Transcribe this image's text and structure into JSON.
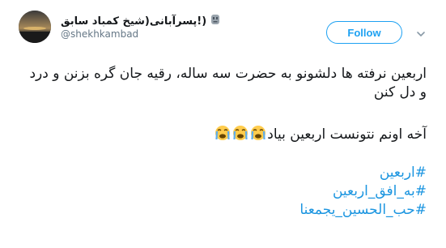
{
  "user": {
    "display_name": "(!پسرآبانی(شیخ کمباد سابق",
    "handle": "@shekhkambad",
    "badge_icon": "moai-icon"
  },
  "follow_label": "Follow",
  "tweet": {
    "line1": "اربعین نرفته ها دلشونو به حضرت سه ساله، رقیه جان گره بزنن و درد و دل کنن",
    "line2": "آخه اونم نتونست اربعین بیاد",
    "hashtags": [
      "#اربعین",
      "#به_افق_اربعین",
      "#حب_الحسین_یجمعنا"
    ]
  },
  "colors": {
    "accent": "#1da1f2",
    "hashtag": "#1b95e0",
    "text": "#14171a",
    "muted": "#657786"
  }
}
